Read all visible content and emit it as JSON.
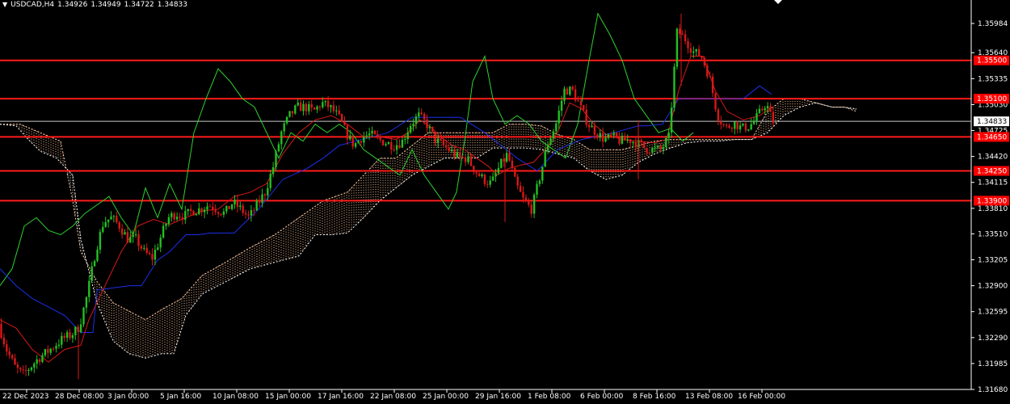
{
  "header": {
    "dropdown_icon": "triangle-down-icon",
    "symbol": "USDCAD,H4",
    "open": "1.34926",
    "high": "1.34949",
    "low": "1.34722",
    "close": "1.34833"
  },
  "chart_data": {
    "type": "candlestick",
    "symbol": "USDCAD",
    "timeframe": "H4",
    "x_labels": [
      "22 Dec 2023",
      "28 Dec 08:00",
      "3 Jan 00:00",
      "5 Jan 16:00",
      "10 Jan 08:00",
      "15 Jan 00:00",
      "17 Jan 16:00",
      "22 Jan 08:00",
      "25 Jan 00:00",
      "29 Jan 16:00",
      "1 Feb 08:00",
      "6 Feb 00:00",
      "8 Feb 16:00",
      "13 Feb 08:00",
      "16 Feb 00:00"
    ],
    "y_ticks": [
      1.35984,
      1.3564,
      1.35335,
      1.3503,
      1.34725,
      1.3442,
      1.34115,
      1.3381,
      1.3351,
      1.33205,
      1.329,
      1.32595,
      1.3229,
      1.31985,
      1.3168
    ],
    "ylim": [
      1.3168,
      1.3626
    ],
    "current_price": 1.34833,
    "current_price_label": "1.34833",
    "levels": [
      {
        "value": 1.3555,
        "label": "1.35500"
      },
      {
        "value": 1.351,
        "label": "1.35100"
      },
      {
        "value": 1.3465,
        "label": "1.34650"
      },
      {
        "value": 1.3425,
        "label": "1.34250"
      },
      {
        "value": 1.339,
        "label": "1.33900"
      }
    ],
    "price_path": [
      [
        0,
        1.3245
      ],
      [
        10,
        1.3215
      ],
      [
        20,
        1.3195
      ],
      [
        30,
        1.3185
      ],
      [
        40,
        1.3195
      ],
      [
        50,
        1.3205
      ],
      [
        60,
        1.3212
      ],
      [
        70,
        1.322
      ],
      [
        80,
        1.3228
      ],
      [
        90,
        1.3232
      ],
      [
        100,
        1.3242
      ],
      [
        110,
        1.328
      ],
      [
        120,
        1.333
      ],
      [
        130,
        1.3365
      ],
      [
        140,
        1.337
      ],
      [
        150,
        1.336
      ],
      [
        160,
        1.3345
      ],
      [
        170,
        1.3345
      ],
      [
        180,
        1.333
      ],
      [
        190,
        1.3322
      ],
      [
        200,
        1.3345
      ],
      [
        210,
        1.337
      ],
      [
        220,
        1.3375
      ],
      [
        230,
        1.3372
      ],
      [
        240,
        1.3378
      ],
      [
        250,
        1.338
      ],
      [
        260,
        1.3385
      ],
      [
        270,
        1.338
      ],
      [
        280,
        1.3375
      ],
      [
        290,
        1.3388
      ],
      [
        300,
        1.338
      ],
      [
        310,
        1.337
      ],
      [
        320,
        1.3385
      ],
      [
        330,
        1.34
      ],
      [
        340,
        1.343
      ],
      [
        350,
        1.347
      ],
      [
        360,
        1.349
      ],
      [
        370,
        1.35
      ],
      [
        380,
        1.35
      ],
      [
        390,
        1.3495
      ],
      [
        400,
        1.3505
      ],
      [
        410,
        1.35
      ],
      [
        420,
        1.349
      ],
      [
        430,
        1.347
      ],
      [
        440,
        1.3455
      ],
      [
        450,
        1.3465
      ],
      [
        460,
        1.3468
      ],
      [
        470,
        1.3462
      ],
      [
        480,
        1.3458
      ],
      [
        490,
        1.3455
      ],
      [
        500,
        1.346
      ],
      [
        510,
        1.348
      ],
      [
        520,
        1.349
      ],
      [
        530,
        1.348
      ],
      [
        540,
        1.3462
      ],
      [
        550,
        1.3455
      ],
      [
        560,
        1.3448
      ],
      [
        570,
        1.344
      ],
      [
        580,
        1.344
      ],
      [
        590,
        1.3425
      ],
      [
        600,
        1.3415
      ],
      [
        610,
        1.341
      ],
      [
        620,
        1.343
      ],
      [
        630,
        1.3445
      ],
      [
        640,
        1.341
      ],
      [
        650,
        1.339
      ],
      [
        660,
        1.338
      ],
      [
        670,
        1.3418
      ],
      [
        680,
        1.3458
      ],
      [
        690,
        1.348
      ],
      [
        700,
        1.352
      ],
      [
        710,
        1.352
      ],
      [
        720,
        1.35
      ],
      [
        730,
        1.348
      ],
      [
        740,
        1.347
      ],
      [
        750,
        1.3462
      ],
      [
        760,
        1.3465
      ],
      [
        770,
        1.346
      ],
      [
        780,
        1.3462
      ],
      [
        790,
        1.3458
      ],
      [
        800,
        1.3452
      ],
      [
        810,
        1.345
      ],
      [
        820,
        1.345
      ],
      [
        830,
        1.3465
      ],
      [
        840,
        1.359
      ],
      [
        850,
        1.358
      ],
      [
        860,
        1.3565
      ],
      [
        870,
        1.356
      ],
      [
        880,
        1.3535
      ],
      [
        890,
        1.349
      ],
      [
        900,
        1.3475
      ],
      [
        910,
        1.3482
      ],
      [
        920,
        1.3475
      ],
      [
        930,
        1.3478
      ],
      [
        940,
        1.349
      ],
      [
        950,
        1.3505
      ],
      [
        958,
        1.3483
      ]
    ],
    "wicks": [
      {
        "x": 97,
        "high": 1.3235,
        "low": 1.318
      },
      {
        "x": 625,
        "high": 1.344,
        "low": 1.3365
      },
      {
        "x": 790,
        "high": 1.3485,
        "low": 1.3415
      },
      {
        "x": 843,
        "high": 1.361,
        "low": 1.3525
      }
    ],
    "kijun": [
      [
        0,
        1.331
      ],
      [
        20,
        1.329
      ],
      [
        40,
        1.3275
      ],
      [
        60,
        1.3265
      ],
      [
        80,
        1.3255
      ],
      [
        100,
        1.3235
      ],
      [
        115,
        1.3235
      ],
      [
        120,
        1.3285
      ],
      [
        160,
        1.329
      ],
      [
        175,
        1.329
      ],
      [
        195,
        1.332
      ],
      [
        210,
        1.333
      ],
      [
        230,
        1.335
      ],
      [
        245,
        1.335
      ],
      [
        260,
        1.3352
      ],
      [
        290,
        1.3352
      ],
      [
        320,
        1.338
      ],
      [
        350,
        1.3415
      ],
      [
        380,
        1.3428
      ],
      [
        400,
        1.344
      ],
      [
        420,
        1.3455
      ],
      [
        440,
        1.346
      ],
      [
        480,
        1.347
      ],
      [
        510,
        1.3488
      ],
      [
        540,
        1.3488
      ],
      [
        570,
        1.3488
      ],
      [
        600,
        1.347
      ],
      [
        640,
        1.344
      ],
      [
        665,
        1.3425
      ],
      [
        690,
        1.345
      ],
      [
        720,
        1.3462
      ],
      [
        760,
        1.347
      ],
      [
        790,
        1.3478
      ],
      [
        800,
        1.3478
      ],
      [
        820,
        1.348
      ],
      [
        840,
        1.351
      ],
      [
        880,
        1.351
      ],
      [
        920,
        1.351
      ],
      [
        940,
        1.3525
      ],
      [
        955,
        1.3515
      ]
    ],
    "tenkan": [
      [
        0,
        1.325
      ],
      [
        20,
        1.324
      ],
      [
        40,
        1.3215
      ],
      [
        60,
        1.32
      ],
      [
        80,
        1.3215
      ],
      [
        100,
        1.322
      ],
      [
        110,
        1.325
      ],
      [
        130,
        1.329
      ],
      [
        150,
        1.333
      ],
      [
        170,
        1.336
      ],
      [
        190,
        1.3368
      ],
      [
        210,
        1.3362
      ],
      [
        230,
        1.337
      ],
      [
        250,
        1.3378
      ],
      [
        270,
        1.338
      ],
      [
        290,
        1.3395
      ],
      [
        310,
        1.34
      ],
      [
        330,
        1.341
      ],
      [
        350,
        1.3445
      ],
      [
        370,
        1.347
      ],
      [
        390,
        1.3485
      ],
      [
        410,
        1.349
      ],
      [
        430,
        1.348
      ],
      [
        450,
        1.3465
      ],
      [
        470,
        1.3465
      ],
      [
        490,
        1.3462
      ],
      [
        505,
        1.347
      ],
      [
        520,
        1.3485
      ],
      [
        535,
        1.3475
      ],
      [
        545,
        1.3465
      ],
      [
        560,
        1.3455
      ],
      [
        575,
        1.345
      ],
      [
        590,
        1.344
      ],
      [
        605,
        1.343
      ],
      [
        615,
        1.342
      ],
      [
        630,
        1.3428
      ],
      [
        645,
        1.3432
      ],
      [
        660,
        1.3435
      ],
      [
        675,
        1.345
      ],
      [
        690,
        1.347
      ],
      [
        705,
        1.3505
      ],
      [
        720,
        1.3498
      ],
      [
        735,
        1.348
      ],
      [
        750,
        1.3468
      ],
      [
        770,
        1.3462
      ],
      [
        790,
        1.346
      ],
      [
        810,
        1.3458
      ],
      [
        825,
        1.3462
      ],
      [
        840,
        1.352
      ],
      [
        855,
        1.356
      ],
      [
        870,
        1.356
      ],
      [
        885,
        1.352
      ],
      [
        900,
        1.3495
      ],
      [
        920,
        1.3485
      ],
      [
        940,
        1.349
      ],
      [
        955,
        1.35
      ]
    ],
    "chikou": [
      [
        0,
        1.329
      ],
      [
        15,
        1.331
      ],
      [
        30,
        1.336
      ],
      [
        45,
        1.337
      ],
      [
        60,
        1.3355
      ],
      [
        75,
        1.335
      ],
      [
        90,
        1.336
      ],
      [
        105,
        1.3375
      ],
      [
        120,
        1.3385
      ],
      [
        135,
        1.3395
      ],
      [
        150,
        1.337
      ],
      [
        165,
        1.335
      ],
      [
        180,
        1.3405
      ],
      [
        195,
        1.337
      ],
      [
        210,
        1.341
      ],
      [
        225,
        1.338
      ],
      [
        240,
        1.347
      ],
      [
        255,
        1.351
      ],
      [
        270,
        1.3545
      ],
      [
        285,
        1.353
      ],
      [
        300,
        1.351
      ],
      [
        315,
        1.35
      ],
      [
        330,
        1.347
      ],
      [
        345,
        1.344
      ],
      [
        360,
        1.347
      ],
      [
        375,
        1.346
      ],
      [
        390,
        1.348
      ],
      [
        405,
        1.347
      ],
      [
        420,
        1.348
      ],
      [
        435,
        1.347
      ],
      [
        450,
        1.345
      ],
      [
        465,
        1.344
      ],
      [
        480,
        1.343
      ],
      [
        495,
        1.342
      ],
      [
        510,
        1.345
      ],
      [
        525,
        1.342
      ],
      [
        540,
        1.34
      ],
      [
        555,
        1.338
      ],
      [
        565,
        1.34
      ],
      [
        575,
        1.346
      ],
      [
        585,
        1.353
      ],
      [
        600,
        1.356
      ],
      [
        610,
        1.351
      ],
      [
        625,
        1.348
      ],
      [
        640,
        1.349
      ],
      [
        655,
        1.348
      ],
      [
        670,
        1.346
      ],
      [
        685,
        1.345
      ],
      [
        700,
        1.344
      ],
      [
        715,
        1.348
      ],
      [
        730,
        1.356
      ],
      [
        740,
        1.361
      ],
      [
        755,
        1.3585
      ],
      [
        770,
        1.3555
      ],
      [
        785,
        1.351
      ],
      [
        800,
        1.349
      ],
      [
        815,
        1.347
      ],
      [
        830,
        1.3475
      ],
      [
        845,
        1.346
      ],
      [
        858,
        1.347
      ]
    ],
    "cloud_a": [
      [
        0,
        1.348
      ],
      [
        25,
        1.348
      ],
      [
        50,
        1.347
      ],
      [
        75,
        1.346
      ],
      [
        90,
        1.339
      ],
      [
        100,
        1.333
      ],
      [
        120,
        1.3295
      ],
      [
        140,
        1.327
      ],
      [
        160,
        1.326
      ],
      [
        180,
        1.325
      ],
      [
        200,
        1.3262
      ],
      [
        225,
        1.3275
      ],
      [
        250,
        1.3302
      ],
      [
        280,
        1.3318
      ],
      [
        310,
        1.3335
      ],
      [
        340,
        1.335
      ],
      [
        370,
        1.337
      ],
      [
        400,
        1.339
      ],
      [
        430,
        1.34
      ],
      [
        450,
        1.342
      ],
      [
        470,
        1.344
      ],
      [
        490,
        1.344
      ],
      [
        510,
        1.3455
      ],
      [
        530,
        1.347
      ],
      [
        550,
        1.347
      ],
      [
        570,
        1.347
      ],
      [
        590,
        1.347
      ],
      [
        610,
        1.347
      ],
      [
        630,
        1.348
      ],
      [
        650,
        1.348
      ],
      [
        670,
        1.3478
      ],
      [
        690,
        1.3468
      ],
      [
        710,
        1.3462
      ],
      [
        730,
        1.345
      ],
      [
        750,
        1.345
      ],
      [
        770,
        1.345
      ],
      [
        790,
        1.3455
      ],
      [
        810,
        1.346
      ],
      [
        830,
        1.3462
      ],
      [
        850,
        1.3462
      ],
      [
        870,
        1.3462
      ],
      [
        890,
        1.3462
      ],
      [
        910,
        1.3462
      ],
      [
        930,
        1.3462
      ],
      [
        950,
        1.3495
      ],
      [
        970,
        1.351
      ],
      [
        990,
        1.351
      ],
      [
        1010,
        1.3505
      ],
      [
        1030,
        1.35
      ],
      [
        1045,
        1.35
      ],
      [
        1060,
        1.3495
      ]
    ],
    "cloud_b": [
      [
        0,
        1.348
      ],
      [
        20,
        1.3478
      ],
      [
        35,
        1.3462
      ],
      [
        50,
        1.3448
      ],
      [
        70,
        1.344
      ],
      [
        90,
        1.342
      ],
      [
        100,
        1.3345
      ],
      [
        120,
        1.327
      ],
      [
        140,
        1.3225
      ],
      [
        160,
        1.321
      ],
      [
        180,
        1.3205
      ],
      [
        200,
        1.321
      ],
      [
        215,
        1.321
      ],
      [
        230,
        1.3255
      ],
      [
        250,
        1.328
      ],
      [
        270,
        1.329
      ],
      [
        290,
        1.33
      ],
      [
        310,
        1.331
      ],
      [
        330,
        1.3315
      ],
      [
        350,
        1.332
      ],
      [
        370,
        1.3325
      ],
      [
        390,
        1.335
      ],
      [
        410,
        1.335
      ],
      [
        430,
        1.3352
      ],
      [
        450,
        1.337
      ],
      [
        470,
        1.339
      ],
      [
        490,
        1.3405
      ],
      [
        510,
        1.342
      ],
      [
        530,
        1.343
      ],
      [
        550,
        1.344
      ],
      [
        570,
        1.344
      ],
      [
        590,
        1.344
      ],
      [
        610,
        1.3452
      ],
      [
        630,
        1.3452
      ],
      [
        650,
        1.3452
      ],
      [
        670,
        1.345
      ],
      [
        690,
        1.3445
      ],
      [
        710,
        1.344
      ],
      [
        730,
        1.3425
      ],
      [
        750,
        1.3415
      ],
      [
        770,
        1.342
      ],
      [
        790,
        1.3435
      ],
      [
        810,
        1.3445
      ],
      [
        830,
        1.3452
      ],
      [
        850,
        1.3458
      ],
      [
        870,
        1.346
      ],
      [
        890,
        1.346
      ],
      [
        910,
        1.3462
      ],
      [
        930,
        1.3462
      ],
      [
        950,
        1.347
      ],
      [
        970,
        1.349
      ],
      [
        990,
        1.35
      ],
      [
        1010,
        1.3505
      ],
      [
        1030,
        1.35
      ],
      [
        1045,
        1.35
      ],
      [
        1060,
        1.3498
      ]
    ],
    "colors": {
      "background": "#000000",
      "bull": "#22c022",
      "bear": "#d81818",
      "level_line": "#ff1a1a",
      "level_label_bg": "#ff0000",
      "kijun": "#1b2fe8",
      "tenkan": "#d81818",
      "chikou": "#2ed12e",
      "cloud_dots": "#ffffff",
      "cloud_dots_bull": "#ffc79e",
      "current_price_line": "#c8c8c8",
      "axis_text": "#ffffff"
    }
  }
}
